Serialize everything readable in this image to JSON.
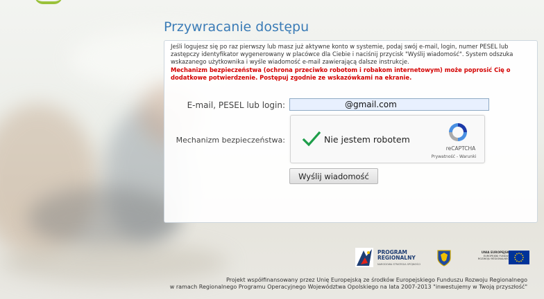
{
  "page": {
    "title": "Przywracanie dostępu",
    "intro": "Jeśli logujesz się po raz pierwszy lub masz już aktywne konto w systemie, podaj swój e-mail, login, numer PESEL lub zastępczy identyfikator wygenerowany w placówce dla Ciebie i naciśnij przycisk \"Wyślij wiadomość\". System odszuka wskazanego użytkownika i wyśle wiadomość e-mail zawierającą dalsze instrukcje.",
    "warning": "Mechanizm bezpieczeństwa (ochrona przeciwko robotom i robakom internetowym) może poprosić Cię o dodatkowe potwierdzenie. Postępuj zgodnie ze wskazówkami na ekranie."
  },
  "form": {
    "email_label": "E-mail, PESEL lub login:",
    "email_value": "@gmail.com",
    "security_label": "Mechanizm bezpieczeństwa:",
    "submit_label": "Wyślij wiadomość"
  },
  "captcha": {
    "label": "Nie jestem robotem",
    "brand": "reCAPTCHA",
    "links": "Prywatność - Warunki",
    "checked": true
  },
  "logos": {
    "program_name_1": "PROGRAM",
    "program_name_2": "REGIONALNY",
    "program_sub": "NARODOWA STRATEGIA SPÓJNOŚCI",
    "eu_title": "UNIA EUROPEJSKA",
    "eu_sub_1": "EUROPEJSKI FUNDUSZ",
    "eu_sub_2": "ROZWOJU REGIONALNEGO"
  },
  "footer": {
    "line1": "Projekt współfinansowany przez Unię Europejską ze środków Europejskiego Funduszu Rozwoju Regionalnego",
    "line2": "w ramach Regionalnego Programu Operacyjnego Województwa Opolskiego na lata 2007-2013 \"inwestujemy w Twoją przyszłość\""
  },
  "colors": {
    "title": "#3a7bb6",
    "warning": "#d40000",
    "checkmark": "#1e9e4a",
    "eu_flag": "#003399"
  }
}
